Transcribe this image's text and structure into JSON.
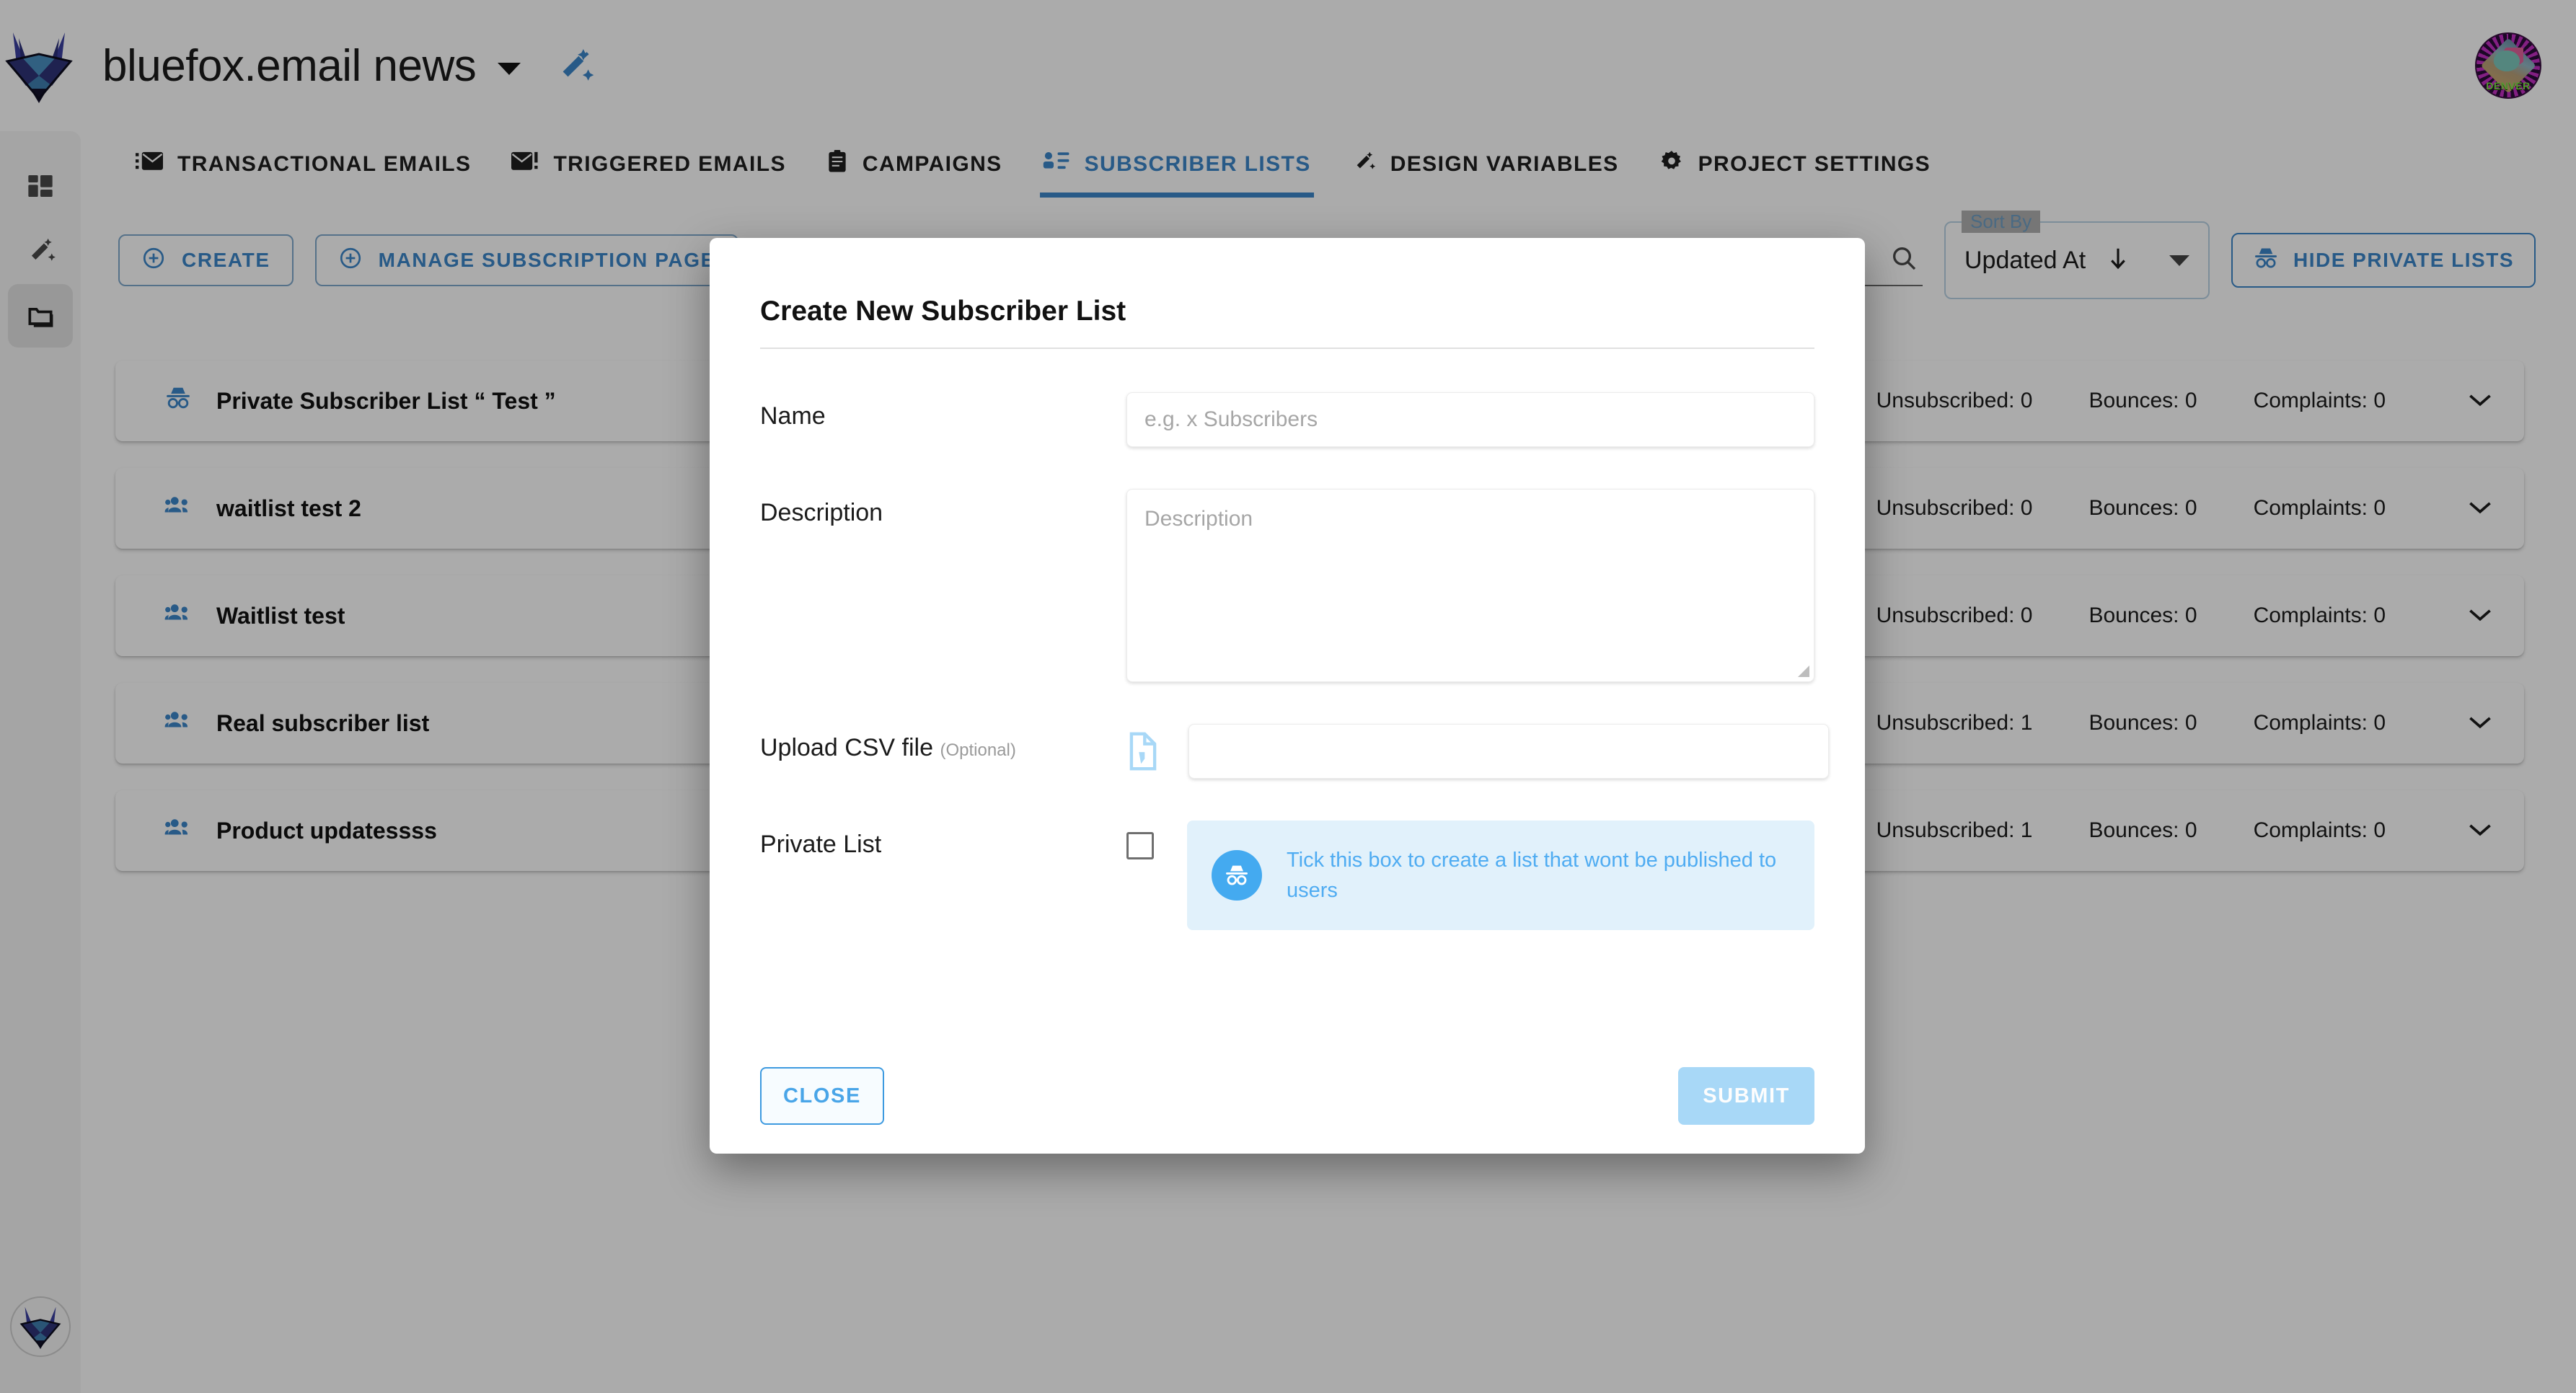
{
  "header": {
    "logo_icon": "bluefox-logo-icon",
    "title": "bluefox.email news",
    "title_caret_icon": "chevron-down-icon",
    "design_icon": "magic-wand-icon",
    "avatar_icon": "user-avatar",
    "avatar_caption": "DENVER",
    "avatar_subcaption": "THE LAST DINOSAUR"
  },
  "rail": {
    "items": [
      {
        "icon": "dashboard-grid-icon",
        "active": false
      },
      {
        "icon": "magic-wand-icon",
        "active": false
      },
      {
        "icon": "folders-icon",
        "active": true
      }
    ],
    "bottom_icon": "bluefox-logo-icon"
  },
  "tabs": [
    {
      "label": "TRANSACTIONAL EMAILS",
      "icon": "transactional-email-icon",
      "active": false
    },
    {
      "label": "TRIGGERED EMAILS",
      "icon": "triggered-email-icon",
      "active": false
    },
    {
      "label": "CAMPAIGNS",
      "icon": "campaign-icon",
      "active": false
    },
    {
      "label": "SUBSCRIBER LISTS",
      "icon": "subscriber-list-icon",
      "active": true
    },
    {
      "label": "DESIGN VARIABLES",
      "icon": "magic-wand-icon",
      "active": false
    },
    {
      "label": "PROJECT SETTINGS",
      "icon": "gear-icon",
      "active": false
    }
  ],
  "toolbar": {
    "create_label": "CREATE",
    "create_icon": "plus-circle-icon",
    "manage_label": "MANAGE SUBSCRIPTION PAGE",
    "manage_icon": "plus-circle-icon",
    "search_icon": "search-icon",
    "search_value": "",
    "sort_by_legend": "Sort By",
    "sort_by_value": "Updated At",
    "sort_direction_icon": "arrow-down-icon",
    "sort_caret_icon": "chevron-down-icon",
    "hide_private_label": "HIDE PRIVATE LISTS",
    "hide_private_icon": "incognito-icon"
  },
  "list": {
    "stat_labels": {
      "unsubscribed": "Unsubscribed:",
      "bounces": "Bounces:",
      "complaints": "Complaints:"
    },
    "rows": [
      {
        "name": "Private Subscriber List “ Test ”",
        "icon": "incognito-icon",
        "unsubscribed": "0",
        "bounces": "0",
        "complaints": "0",
        "chevron": "chevron-down-icon"
      },
      {
        "name": "waitlist test 2",
        "icon": "people-icon",
        "unsubscribed": "0",
        "bounces": "0",
        "complaints": "0",
        "chevron": "chevron-down-icon"
      },
      {
        "name": "Waitlist test",
        "icon": "people-icon",
        "unsubscribed": "0",
        "bounces": "0",
        "complaints": "0",
        "chevron": "chevron-down-icon"
      },
      {
        "name": "Real subscriber list",
        "icon": "people-icon",
        "unsubscribed": "1",
        "bounces": "0",
        "complaints": "0",
        "chevron": "chevron-down-icon"
      },
      {
        "name": "Product updatessss",
        "icon": "people-icon",
        "unsubscribed": "1",
        "bounces": "0",
        "complaints": "0",
        "chevron": "chevron-down-icon"
      }
    ]
  },
  "modal": {
    "title": "Create New Subscriber List",
    "name_label": "Name",
    "name_value": "",
    "name_placeholder": "e.g. x Subscribers",
    "description_label": "Description",
    "description_value": "",
    "description_placeholder": "Description",
    "csv_label": "Upload CSV file",
    "csv_optional": "(Optional)",
    "csv_icon": "csv-file-icon",
    "csv_value": "",
    "private_label": "Private List",
    "private_checked": false,
    "tip_icon": "incognito-icon",
    "tip_text": "Tick this box to create a list that wont be published to users",
    "close_label": "CLOSE",
    "submit_label": "SUBMIT"
  },
  "colors": {
    "accent": "#3d87c9",
    "accent_light": "#a8d8f7",
    "tip_bg": "#e1f1fb",
    "tip_text": "#4facf2"
  }
}
